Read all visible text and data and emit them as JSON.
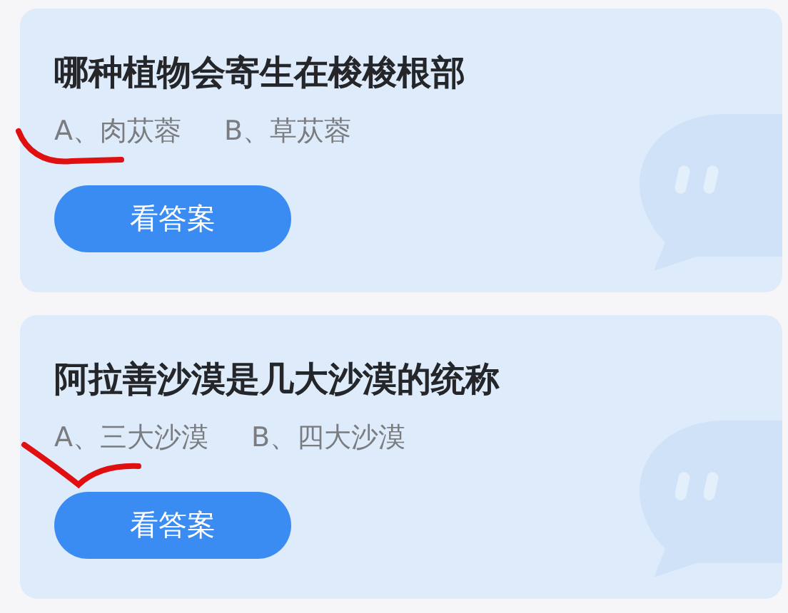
{
  "questions": [
    {
      "title": "哪种植物会寄生在梭梭根部",
      "options": [
        "A、肉苁蓉",
        "B、草苁蓉"
      ],
      "button": "看答案"
    },
    {
      "title": "阿拉善沙漠是几大沙漠的统称",
      "options": [
        "A、三大沙漠",
        "B、四大沙漠"
      ],
      "button": "看答案"
    }
  ]
}
